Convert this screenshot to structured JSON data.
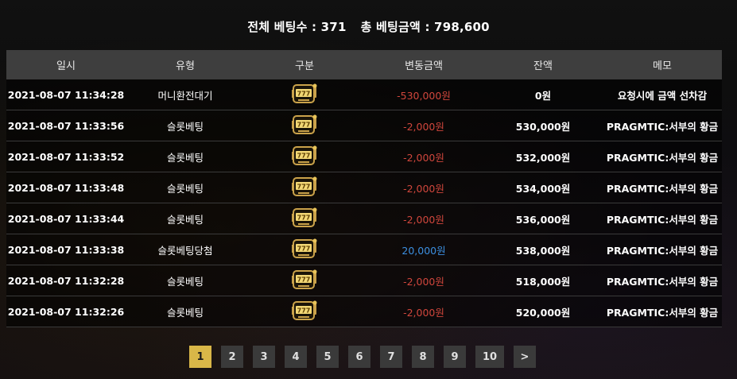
{
  "summary": {
    "total_count_label": "전체 베팅수 : 371",
    "total_amount_label": "총 베팅금액 : 798,600"
  },
  "table": {
    "headers": [
      "일시",
      "유형",
      "구분",
      "변동금액",
      "잔액",
      "메모"
    ],
    "rows": [
      {
        "date": "2021-08-07 11:34:28",
        "type": "머니환전대기",
        "icon": "slot-machine-icon",
        "amount": "-530,000원",
        "amount_sign": "neg",
        "balance": "0원",
        "memo": "요청시에 금액 선차감"
      },
      {
        "date": "2021-08-07 11:33:56",
        "type": "슬롯베팅",
        "icon": "slot-machine-icon",
        "amount": "-2,000원",
        "amount_sign": "neg",
        "balance": "530,000원",
        "memo": "PRAGMTIC:서부의 황금"
      },
      {
        "date": "2021-08-07 11:33:52",
        "type": "슬롯베팅",
        "icon": "slot-machine-icon",
        "amount": "-2,000원",
        "amount_sign": "neg",
        "balance": "532,000원",
        "memo": "PRAGMTIC:서부의 황금"
      },
      {
        "date": "2021-08-07 11:33:48",
        "type": "슬롯베팅",
        "icon": "slot-machine-icon",
        "amount": "-2,000원",
        "amount_sign": "neg",
        "balance": "534,000원",
        "memo": "PRAGMTIC:서부의 황금"
      },
      {
        "date": "2021-08-07 11:33:44",
        "type": "슬롯베팅",
        "icon": "slot-machine-icon",
        "amount": "-2,000원",
        "amount_sign": "neg",
        "balance": "536,000원",
        "memo": "PRAGMTIC:서부의 황금"
      },
      {
        "date": "2021-08-07 11:33:38",
        "type": "슬롯베팅당첨",
        "icon": "slot-machine-icon",
        "amount": "20,000원",
        "amount_sign": "pos",
        "balance": "538,000원",
        "memo": "PRAGMTIC:서부의 황금"
      },
      {
        "date": "2021-08-07 11:32:28",
        "type": "슬롯베팅",
        "icon": "slot-machine-icon",
        "amount": "-2,000원",
        "amount_sign": "neg",
        "balance": "518,000원",
        "memo": "PRAGMTIC:서부의 황금"
      },
      {
        "date": "2021-08-07 11:32:26",
        "type": "슬롯베팅",
        "icon": "slot-machine-icon",
        "amount": "-2,000원",
        "amount_sign": "neg",
        "balance": "520,000원",
        "memo": "PRAGMTIC:서부의 황금"
      }
    ]
  },
  "pagination": {
    "pages": [
      "1",
      "2",
      "3",
      "4",
      "5",
      "6",
      "7",
      "8",
      "9",
      "10"
    ],
    "current": "1",
    "next_label": ">"
  },
  "colors": {
    "negative": "#d0463c",
    "positive": "#3c8fe0",
    "active_page": "#d9b748",
    "header_bg": "#3e3e3e"
  }
}
